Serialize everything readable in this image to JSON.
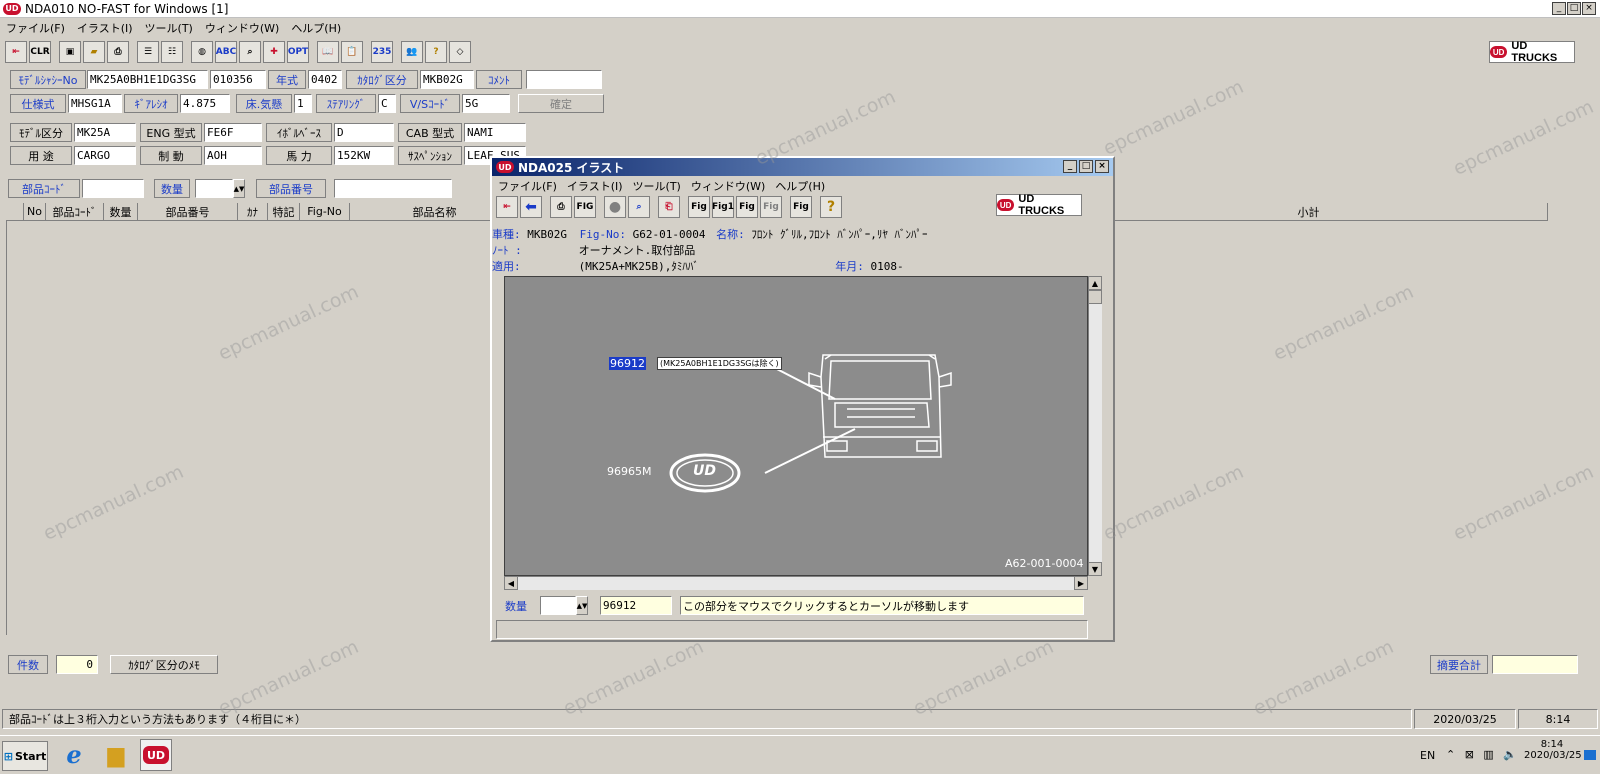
{
  "app": {
    "title": "NDA010 NO-FAST for Windows [1]",
    "brand": "UD TRUCKS",
    "logo_text": "UD"
  },
  "menu": [
    "ファイル(F)",
    "イラスト(I)",
    "ツール(T)",
    "ウィンドウ(W)",
    "ヘルプ(H)"
  ],
  "toolbar": [
    "exit-icon",
    "CLR",
    "save-icon",
    "open-icon",
    "print-icon",
    "list-icon",
    "list2-icon",
    "sphere-icon",
    "ABC",
    "search-icon",
    "plus-icon",
    "OPT",
    "book-icon",
    "clipboard-icon",
    "235",
    "people-icon",
    "help-icon",
    "eraser-icon"
  ],
  "form": {
    "model_chassis_label": "ﾓﾃﾞﾙｼｬｼｰNo",
    "model_chassis_value": "MK25A0BH1E1DG3SG",
    "serial_value": "010356",
    "year_label": "年式",
    "year_value": "0402",
    "catalog_label": "ｶﾀﾛｸﾞ区分",
    "catalog_value": "MKB02G",
    "comment_label": "ｺﾒﾝﾄ",
    "comment_value": "",
    "spec_label": "仕様式",
    "spec_value": "MHSG1A",
    "gear_label": "ｷﾞｱﾚｼｵ",
    "gear_value": "4.875",
    "floor_label": "床.気懸",
    "floor_value": "1",
    "steering_label": "ｽﾃｱﾘﾝｸﾞ",
    "steering_value": "C",
    "vs_label": "V/Sｺｰﾄﾞ",
    "vs_value": "5G",
    "confirm_button": "確定",
    "model_label": "ﾓﾃﾞﾙ区分",
    "model_value": "MK25A",
    "eng_label": "ENG 型式",
    "eng_value": "FE6F",
    "wheelbase_label": "ｲﾎﾞﾙﾍﾞｰｽ",
    "wheelbase_value": "D",
    "cab_label": "CAB 型式",
    "cab_value": "NAMI",
    "use_label": "用 途",
    "use_value": "CARGO",
    "brake_label": "制 動",
    "brake_value": "AOH",
    "power_label": "馬 力",
    "power_value": "152KW",
    "susp_label": "ｻｽﾍﾟﾝｼｮﾝ",
    "susp_value": "LEAF SUS",
    "partcode_label": "部品ｺｰﾄﾞ",
    "qty_label": "数量",
    "partno_label": "部品番号"
  },
  "table": {
    "headers": [
      "No",
      "部品ｺｰﾄﾞ",
      "数量",
      "部品番号",
      "ｶﾅ",
      "特記",
      "Fig-No",
      "部品名称",
      "小計"
    ]
  },
  "bottom": {
    "count_label": "件数",
    "count_value": "0",
    "memo_button": "ｶﾀﾛｸﾞ区分のﾒﾓ",
    "summary_label": "摘要合計",
    "hint": "部品ｺｰﾄﾞは上３桁入力という方法もあります（４桁目に＊）",
    "date": "2020/03/25",
    "time": "8:14"
  },
  "child": {
    "title": "NDA025 イラスト",
    "menu": [
      "ファイル(F)",
      "イラスト(I)",
      "ツール(T)",
      "ウィンドウ(W)",
      "ヘルプ(H)"
    ],
    "tools": [
      "exit-icon",
      "back-arrow-icon",
      "print-icon",
      "FIG",
      "circle-icon",
      "zoom-icon",
      "page-icon",
      "Fig",
      "Fig1",
      "Fig",
      "Fig",
      "Fig",
      "help-icon"
    ],
    "row1_label": "車種:",
    "row1_value": "MKB02G",
    "fig_label": "Fig-No:",
    "fig_value": "G62-01-0004",
    "name_label": "名称:",
    "name_value": "ﾌﾛﾝﾄ ｸﾞﾘﾙ,ﾌﾛﾝﾄ ﾊﾞﾝﾊﾟｰ,ﾘﾔ ﾊﾞﾝﾊﾟｰ",
    "note_label": "ﾉｰﾄ :",
    "note_value": "オーナメント.取付部品",
    "apply_label": "適用:",
    "apply_value": "(MK25A+MK25B),ﾀﾐﾊﾊﾞ",
    "ym_label": "年月:",
    "ym_value": "0108-",
    "callout1": "96912",
    "callout1_note": "(MK25A0BH1E1DG3SGは除く)",
    "callout2": "96965M",
    "emblem_text": "UD",
    "fig_code": "A62-001-0004",
    "qty_label": "数量",
    "part_value": "96912",
    "message": "この部分をマウスでクリックするとカーソルが移動します"
  },
  "taskbar": {
    "start": "Start",
    "lang": "EN",
    "time": "8:14",
    "date": "2020/03/25"
  },
  "watermark": "epcmanual.com"
}
